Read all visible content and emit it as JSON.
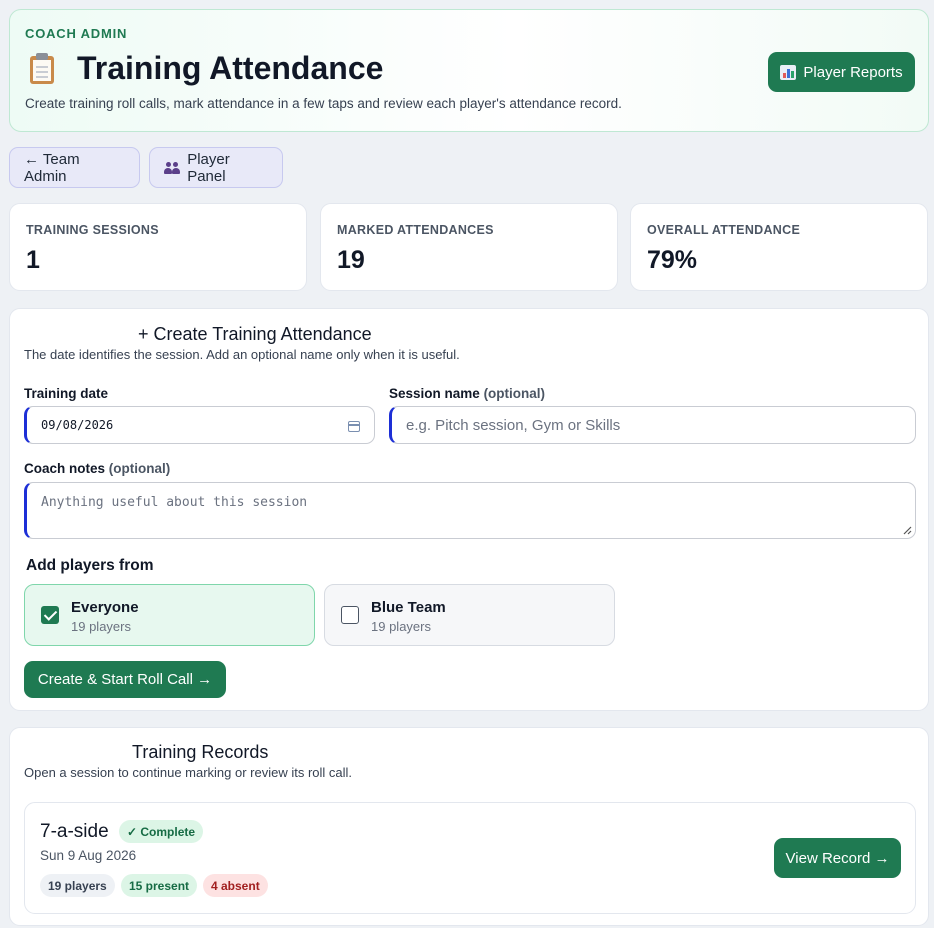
{
  "header": {
    "eyebrow": "COACH ADMIN",
    "title": "Training Attendance",
    "subtitle": "Create training roll calls, mark attendance in a few taps and review each player's attendance record.",
    "reports_button": "Player Reports"
  },
  "nav": {
    "team_admin": "← Team Admin",
    "player_panel": "Player Panel"
  },
  "stats": [
    {
      "label": "TRAINING SESSIONS",
      "value": "1"
    },
    {
      "label": "MARKED ATTENDANCES",
      "value": "19"
    },
    {
      "label": "OVERALL ATTENDANCE",
      "value": "79%"
    }
  ],
  "create": {
    "title": "+  Create Training Attendance",
    "subtitle": "The date identifies the session. Add an optional name only when it is useful.",
    "date_label": "Training date",
    "date_value": "09/08/2026",
    "session_label": "Session name",
    "optional": "(optional)",
    "session_placeholder": "e.g. Pitch session, Gym or Skills",
    "notes_label": "Coach notes",
    "notes_placeholder": "Anything useful about this session",
    "add_players_label": "Add players from",
    "groups": [
      {
        "name": "Everyone",
        "count": "19 players",
        "checked": true
      },
      {
        "name": "Blue Team",
        "count": "19 players",
        "checked": false
      }
    ],
    "submit": "Create & Start Roll Call →"
  },
  "records": {
    "title": "Training Records",
    "subtitle": "Open a session to continue marking or review its roll call.",
    "items": [
      {
        "name": "7-a-side",
        "status": "✓ Complete",
        "date": "Sun 9 Aug 2026",
        "players": "19 players",
        "present": "15 present",
        "absent": "4 absent",
        "action": "View Record →"
      }
    ]
  },
  "colors": {
    "accent": "#1f7a52",
    "focus": "#1d2fd6",
    "present_bg": "#dcf5e6",
    "absent_bg": "#fde2e2"
  }
}
